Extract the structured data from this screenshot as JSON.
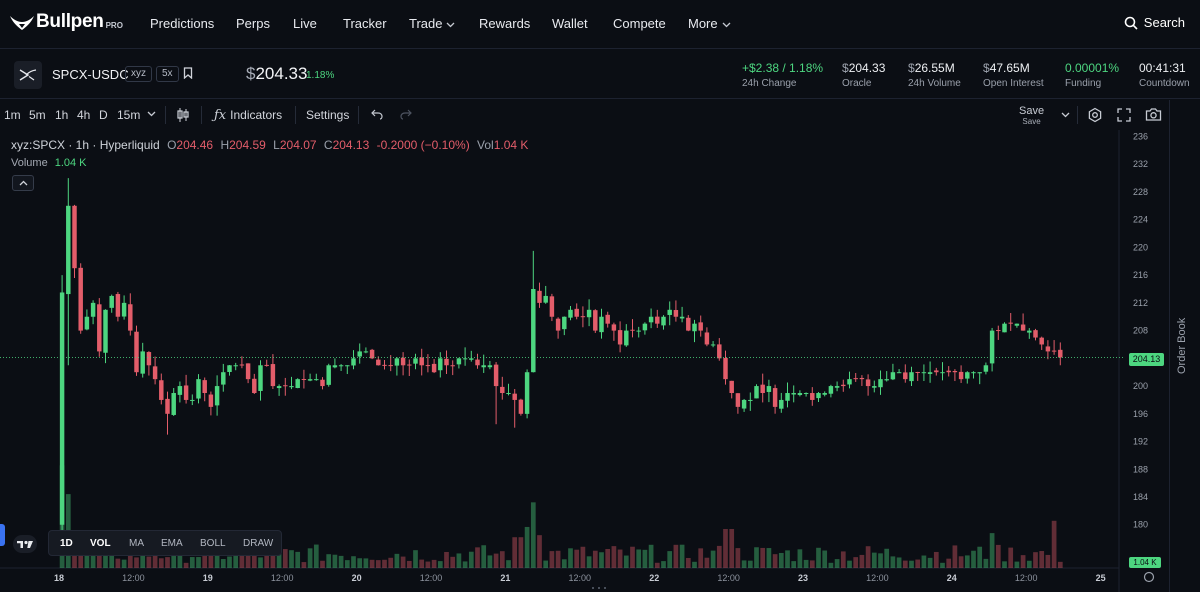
{
  "nav": {
    "logo_text": "Bullpen",
    "logo_pro": "PRO",
    "items": [
      {
        "label": "Predictions"
      },
      {
        "label": "Perps"
      },
      {
        "label": "Live"
      },
      {
        "label": "Tracker"
      },
      {
        "label": "Trade",
        "dropdown": true
      },
      {
        "label": "Rewards"
      },
      {
        "label": "Wallet"
      },
      {
        "label": "Compete"
      },
      {
        "label": "More",
        "dropdown": true
      }
    ],
    "search_label": "Search"
  },
  "market": {
    "pair_base": "SPCX",
    "pair_sep": "-",
    "pair_quote": "USDC",
    "exchange_badge": "xyz",
    "leverage_badge": "5x",
    "price_currency": "$",
    "price": "204.33",
    "price_change_pct": "1.18%",
    "stats": [
      {
        "value": "+$2.38 / 1.18%",
        "label": "24h Change",
        "green": true
      },
      {
        "currency": "$",
        "value": "204.33",
        "label": "Oracle"
      },
      {
        "currency": "$",
        "value": "26.55M",
        "label": "24h Volume"
      },
      {
        "currency": "$",
        "value": "47.65M",
        "label": "Open Interest"
      },
      {
        "value": "0.00001%",
        "label": "Funding",
        "green": true
      },
      {
        "value": "00:41:31",
        "label": "Countdown"
      }
    ]
  },
  "toolbar": {
    "intervals": [
      "1m",
      "5m",
      "1h",
      "4h",
      "D",
      "15m"
    ],
    "indicators_label": "Indicators",
    "settings_label": "Settings",
    "save_label": "Save",
    "save_sub": "Save"
  },
  "legend": {
    "title": "xyz:SPCX · 1h · Hyperliquid",
    "o_key": "O",
    "o_val": "204.46",
    "h_key": "H",
    "h_val": "204.59",
    "l_key": "L",
    "l_val": "204.07",
    "c_key": "C",
    "c_val": "204.13",
    "change": "-0.2000 (−0.10%)",
    "vol_key": "Vol",
    "vol_val": "1.04 K",
    "volume_label": "Volume",
    "volume_val": "1.04 K"
  },
  "indicator_bar": [
    "1D",
    "VOL",
    "MA",
    "EMA",
    "BOLL",
    "DRAW"
  ],
  "order_book_label": "Order Book",
  "colors": {
    "up": "#4dd680",
    "down": "#e35d6a",
    "bg": "#0b0e14",
    "accent": "#3a72f0"
  },
  "chart_data": {
    "type": "candlestick",
    "current_price_label": "204.13",
    "current_price": 204.13,
    "volume_last_label": "1.04 K",
    "y_ticks": [
      180,
      184,
      188,
      192,
      196,
      200,
      204,
      208,
      212,
      216,
      220,
      224,
      228,
      232,
      236
    ],
    "ylim": [
      177.8,
      236.5
    ],
    "x_ticks": [
      {
        "label": "18",
        "bar": 0,
        "bold": true
      },
      {
        "label": "12:00",
        "bar": 12
      },
      {
        "label": "19",
        "bar": 24,
        "bold": true
      },
      {
        "label": "12:00",
        "bar": 36
      },
      {
        "label": "20",
        "bar": 48,
        "bold": true
      },
      {
        "label": "12:00",
        "bar": 60
      },
      {
        "label": "21",
        "bar": 72,
        "bold": true
      },
      {
        "label": "12:00",
        "bar": 84
      },
      {
        "label": "22",
        "bar": 96,
        "bold": true
      },
      {
        "label": "12:00",
        "bar": 108
      },
      {
        "label": "23",
        "bar": 120,
        "bold": true
      },
      {
        "label": "12:00",
        "bar": 132
      },
      {
        "label": "24",
        "bar": 144,
        "bold": true
      },
      {
        "label": "12:00",
        "bar": 156
      },
      {
        "label": "25",
        "bar": 168,
        "bold": true
      }
    ],
    "close_anchors": [
      [
        0,
        213.5
      ],
      [
        1,
        226
      ],
      [
        2,
        217
      ],
      [
        3,
        208
      ],
      [
        4,
        210
      ],
      [
        5,
        212
      ],
      [
        6,
        205
      ],
      [
        7,
        211
      ],
      [
        8,
        213
      ],
      [
        9,
        210
      ],
      [
        10,
        212
      ],
      [
        11,
        208
      ],
      [
        12,
        202
      ],
      [
        13,
        205
      ],
      [
        14,
        203
      ],
      [
        15,
        201
      ],
      [
        16,
        198
      ],
      [
        17,
        196
      ],
      [
        18,
        199
      ],
      [
        19,
        200
      ],
      [
        20,
        198
      ],
      [
        21,
        198
      ],
      [
        22,
        201
      ],
      [
        23,
        199
      ],
      [
        24,
        197
      ],
      [
        25,
        200
      ],
      [
        26,
        202
      ],
      [
        27,
        203
      ],
      [
        28,
        203
      ],
      [
        29,
        203
      ],
      [
        30,
        201
      ],
      [
        31,
        199
      ],
      [
        32,
        203
      ],
      [
        33,
        203
      ],
      [
        34,
        200
      ],
      [
        35,
        200
      ],
      [
        36,
        200
      ],
      [
        37,
        200
      ],
      [
        38,
        201
      ],
      [
        39,
        201
      ],
      [
        40,
        201
      ],
      [
        41,
        201
      ],
      [
        42,
        200
      ],
      [
        43,
        203
      ],
      [
        44,
        203
      ],
      [
        45,
        203
      ],
      [
        46,
        203
      ],
      [
        47,
        204
      ],
      [
        48,
        205
      ],
      [
        49,
        205
      ],
      [
        50,
        204
      ],
      [
        51,
        203
      ],
      [
        52,
        203
      ],
      [
        53,
        203
      ],
      [
        54,
        204
      ],
      [
        55,
        203
      ],
      [
        56,
        203
      ],
      [
        57,
        204
      ],
      [
        58,
        203
      ],
      [
        59,
        203
      ],
      [
        60,
        202
      ],
      [
        61,
        204
      ],
      [
        62,
        203
      ],
      [
        63,
        203
      ],
      [
        64,
        204
      ],
      [
        65,
        204
      ],
      [
        66,
        204
      ],
      [
        67,
        203
      ],
      [
        68,
        203
      ],
      [
        69,
        203
      ],
      [
        70,
        200
      ],
      [
        71,
        199
      ],
      [
        72,
        199
      ],
      [
        73,
        198
      ],
      [
        74,
        196
      ],
      [
        75,
        202
      ],
      [
        76,
        214
      ],
      [
        77,
        212
      ],
      [
        78,
        213
      ],
      [
        79,
        210
      ],
      [
        80,
        208
      ],
      [
        81,
        210
      ],
      [
        82,
        211
      ],
      [
        83,
        210
      ],
      [
        84,
        210
      ],
      [
        85,
        211
      ],
      [
        86,
        208
      ],
      [
        87,
        210
      ],
      [
        88,
        209
      ],
      [
        89,
        208
      ],
      [
        90,
        206
      ],
      [
        91,
        208
      ],
      [
        92,
        208
      ],
      [
        93,
        208
      ],
      [
        94,
        209
      ],
      [
        95,
        210
      ],
      [
        96,
        209
      ],
      [
        97,
        210
      ],
      [
        98,
        211
      ],
      [
        99,
        210
      ],
      [
        100,
        210
      ],
      [
        101,
        208
      ],
      [
        102,
        209
      ],
      [
        103,
        208
      ],
      [
        104,
        206
      ],
      [
        105,
        206
      ],
      [
        106,
        204
      ],
      [
        107,
        201
      ],
      [
        108,
        199
      ],
      [
        109,
        197
      ],
      [
        110,
        198
      ],
      [
        111,
        198
      ],
      [
        112,
        200
      ],
      [
        113,
        199
      ],
      [
        114,
        200
      ],
      [
        115,
        197
      ],
      [
        116,
        198
      ],
      [
        117,
        199
      ],
      [
        118,
        199
      ],
      [
        119,
        199
      ],
      [
        120,
        199
      ],
      [
        121,
        198
      ],
      [
        122,
        199
      ],
      [
        123,
        199
      ],
      [
        124,
        200
      ],
      [
        125,
        200
      ],
      [
        126,
        200
      ],
      [
        127,
        201
      ],
      [
        128,
        201
      ],
      [
        129,
        201
      ],
      [
        130,
        200
      ],
      [
        131,
        200
      ],
      [
        132,
        201
      ],
      [
        133,
        201
      ],
      [
        134,
        202
      ],
      [
        135,
        202
      ],
      [
        136,
        201
      ],
      [
        137,
        202
      ],
      [
        138,
        202
      ],
      [
        139,
        202
      ],
      [
        140,
        202
      ],
      [
        141,
        202
      ],
      [
        142,
        202
      ],
      [
        143,
        202
      ],
      [
        144,
        202
      ],
      [
        145,
        201
      ],
      [
        146,
        202
      ],
      [
        147,
        202
      ],
      [
        148,
        202
      ],
      [
        149,
        203
      ],
      [
        150,
        208
      ],
      [
        151,
        208
      ],
      [
        152,
        209
      ],
      [
        153,
        209
      ],
      [
        154,
        209
      ],
      [
        155,
        208
      ],
      [
        156,
        208
      ],
      [
        157,
        207
      ],
      [
        158,
        206
      ],
      [
        159,
        205
      ],
      [
        160,
        205
      ],
      [
        161,
        204.13
      ]
    ],
    "volume_range": [
      0,
      1
    ]
  }
}
